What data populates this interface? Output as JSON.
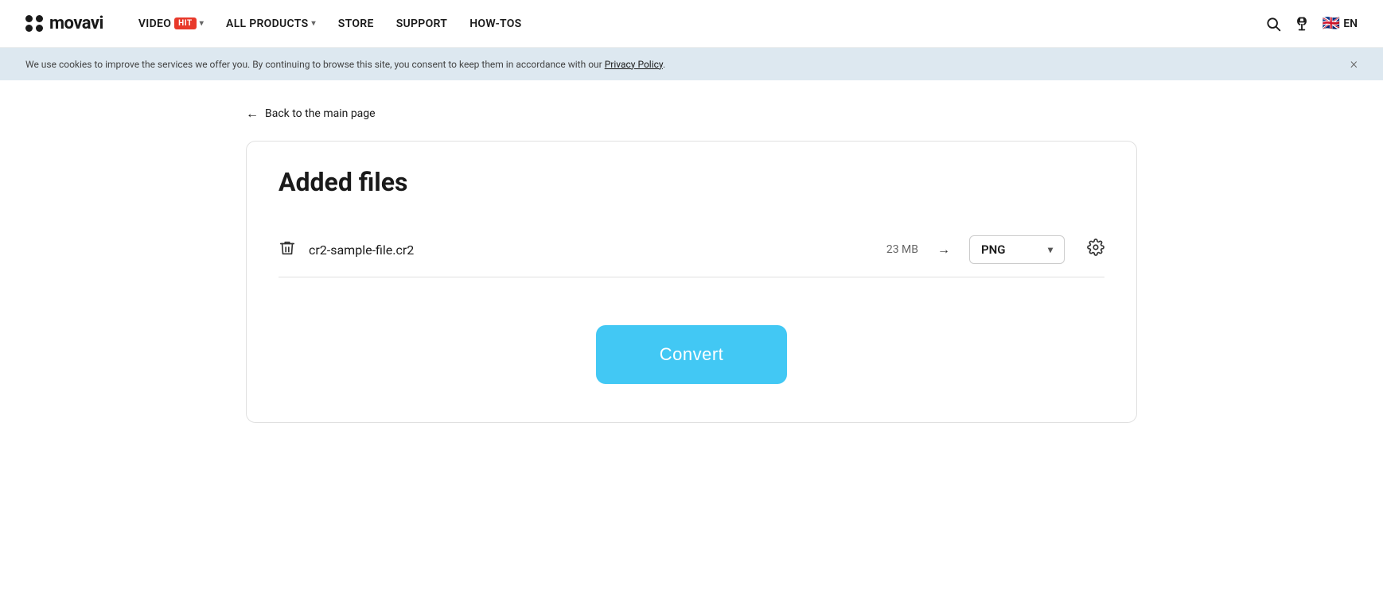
{
  "header": {
    "logo_text": "movavi",
    "nav_items": [
      {
        "label": "VIDEO",
        "has_chevron": true,
        "badge": "HIT"
      },
      {
        "label": "ALL PRODUCTS",
        "has_chevron": true,
        "badge": null
      },
      {
        "label": "STORE",
        "has_chevron": false,
        "badge": null
      },
      {
        "label": "SUPPORT",
        "has_chevron": false,
        "badge": null
      },
      {
        "label": "HOW-TOS",
        "has_chevron": false,
        "badge": null
      }
    ],
    "search_icon": "🔍",
    "account_icon": "⎋",
    "flag": "🇬🇧",
    "language": "EN"
  },
  "cookie_banner": {
    "text": "We use cookies to improve the services we offer you. By continuing to browse this site, you consent to keep them in accordance with our ",
    "link_text": "Privacy Policy",
    "close_label": "×"
  },
  "back_link": {
    "label": "Back to the main page"
  },
  "card": {
    "title": "Added files",
    "file": {
      "name": "cr2-sample-file.cr2",
      "size": "23 MB",
      "format": "PNG"
    },
    "convert_button_label": "Convert"
  }
}
